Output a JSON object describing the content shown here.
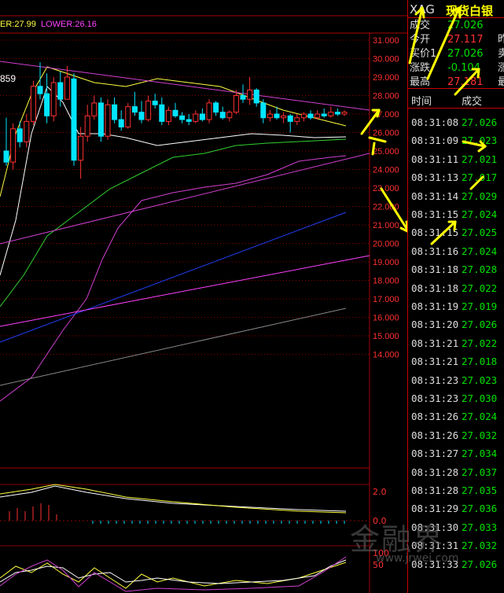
{
  "indicator": {
    "upper_partial": "ER:27.99",
    "lower": "LOWER:26.16",
    "high_marker": "859"
  },
  "chart_data": {
    "type": "candlestick",
    "title": "",
    "price_axis": [
      "31.000",
      "30.000",
      "29.000",
      "28.000",
      "27.000",
      "26.000",
      "25.000",
      "24.000",
      "23.000",
      "22.000",
      "21.000",
      "20.000",
      "19.000",
      "18.000",
      "17.000",
      "16.000",
      "15.000",
      "14.000"
    ],
    "ylim": [
      14.0,
      31.0
    ],
    "sub1_axis": [
      "2.0",
      "0.0"
    ],
    "sub2_axis": [
      "100",
      "50"
    ],
    "candles": [
      [
        25.0,
        26.8,
        24.2,
        24.4
      ],
      [
        24.4,
        26.5,
        24.0,
        26.2
      ],
      [
        26.2,
        26.6,
        25.2,
        25.5
      ],
      [
        25.5,
        27.0,
        25.2,
        26.6
      ],
      [
        26.6,
        28.8,
        26.4,
        28.5
      ],
      [
        28.5,
        29.8,
        27.8,
        28.1
      ],
      [
        28.1,
        29.2,
        26.5,
        26.9
      ],
      [
        26.9,
        29.0,
        26.6,
        28.7
      ],
      [
        28.7,
        29.3,
        27.4,
        27.8
      ],
      [
        27.8,
        29.6,
        28.2,
        29.0
      ],
      [
        28.9,
        29.2,
        24.2,
        24.5
      ],
      [
        24.5,
        26.3,
        23.5,
        25.8
      ],
      [
        25.8,
        27.5,
        25.5,
        26.9
      ],
      [
        26.9,
        28.0,
        26.7,
        27.6
      ],
      [
        27.6,
        27.9,
        25.5,
        25.8
      ],
      [
        25.8,
        27.8,
        25.6,
        27.5
      ],
      [
        27.5,
        27.9,
        26.5,
        26.7
      ],
      [
        26.7,
        27.2,
        26.1,
        26.3
      ],
      [
        26.3,
        27.6,
        26.2,
        27.4
      ],
      [
        27.4,
        28.2,
        26.9,
        27.1
      ],
      [
        27.1,
        27.7,
        26.5,
        26.7
      ],
      [
        26.7,
        28.0,
        26.6,
        27.7
      ],
      [
        27.7,
        28.1,
        27.3,
        27.5
      ],
      [
        27.5,
        27.9,
        26.4,
        26.6
      ],
      [
        26.6,
        27.4,
        26.4,
        27.2
      ],
      [
        27.2,
        27.6,
        26.8,
        26.9
      ],
      [
        26.9,
        27.1,
        26.5,
        26.7
      ],
      [
        26.7,
        27.0,
        26.4,
        26.6
      ],
      [
        26.6,
        27.2,
        26.5,
        27.0
      ],
      [
        27.0,
        27.3,
        26.6,
        26.7
      ],
      [
        26.7,
        27.8,
        26.5,
        27.6
      ],
      [
        27.6,
        27.7,
        26.9,
        27.1
      ],
      [
        27.1,
        27.4,
        26.7,
        26.8
      ],
      [
        26.8,
        27.2,
        26.6,
        27.1
      ],
      [
        27.1,
        28.3,
        27.0,
        28.0
      ],
      [
        28.0,
        28.6,
        27.6,
        27.8
      ],
      [
        27.8,
        29.0,
        27.5,
        28.3
      ],
      [
        28.3,
        28.4,
        27.4,
        27.6
      ],
      [
        27.6,
        27.8,
        26.5,
        26.8
      ],
      [
        26.8,
        27.2,
        26.6,
        27.0
      ],
      [
        27.0,
        27.4,
        26.7,
        26.8
      ],
      [
        26.8,
        27.1,
        26.5,
        26.9
      ],
      [
        26.9,
        27.0,
        26.0,
        26.6
      ],
      [
        26.6,
        27.0,
        26.4,
        26.8
      ],
      [
        26.8,
        27.1,
        26.6,
        27.0
      ],
      [
        27.0,
        27.2,
        26.7,
        26.8
      ],
      [
        26.8,
        27.2,
        26.7,
        27.0
      ],
      [
        27.0,
        27.3,
        26.8,
        26.9
      ],
      [
        26.9,
        27.4,
        26.8,
        27.1
      ],
      [
        27.1,
        27.3,
        26.9,
        27.0
      ],
      [
        27.0,
        27.2,
        26.9,
        27.1
      ]
    ]
  },
  "panel": {
    "symbol": "XAG",
    "name": "现货白银",
    "rows": [
      {
        "label": "成交",
        "value": "27.026",
        "cut": "",
        "color": "green"
      },
      {
        "label": "今开",
        "value": "27.117",
        "cut": "昨",
        "color": "red"
      },
      {
        "label": "买价1",
        "value": "27.026",
        "cut": "卖",
        "color": "green"
      },
      {
        "label": "涨跌",
        "value": "-0.104",
        "cut": "涨",
        "color": "green"
      },
      {
        "label": "最高",
        "value": "27.181",
        "cut": "最",
        "color": "red"
      }
    ],
    "col_time": "时间",
    "col_price": "成交",
    "ticks": [
      {
        "time": "08:31:08",
        "price": "27.026"
      },
      {
        "time": "08:31:09",
        "price": "27.023"
      },
      {
        "time": "08:31:11",
        "price": "27.021"
      },
      {
        "time": "08:31:13",
        "price": "27.017"
      },
      {
        "time": "08:31:14",
        "price": "27.029"
      },
      {
        "time": "08:31:15",
        "price": "27.024"
      },
      {
        "time": "08:31:15",
        "price": "27.025"
      },
      {
        "time": "08:31:16",
        "price": "27.024"
      },
      {
        "time": "08:31:18",
        "price": "27.028"
      },
      {
        "time": "08:31:18",
        "price": "27.022"
      },
      {
        "time": "08:31:19",
        "price": "27.019"
      },
      {
        "time": "08:31:20",
        "price": "27.026"
      },
      {
        "time": "08:31:21",
        "price": "27.022"
      },
      {
        "time": "08:31:21",
        "price": "27.018"
      },
      {
        "time": "08:31:23",
        "price": "27.023"
      },
      {
        "time": "08:31:23",
        "price": "27.030"
      },
      {
        "time": "08:31:26",
        "price": "27.024"
      },
      {
        "time": "08:31:26",
        "price": "27.032"
      },
      {
        "time": "08:31:27",
        "price": "27.034"
      },
      {
        "time": "08:31:28",
        "price": "27.037"
      },
      {
        "time": "08:31:28",
        "price": "27.035"
      },
      {
        "time": "08:31:29",
        "price": "27.036"
      },
      {
        "time": "08:31:30",
        "price": "27.033"
      },
      {
        "time": "08:31:31",
        "price": "27.032"
      },
      {
        "time": "08:31:33",
        "price": "27.026"
      }
    ]
  },
  "watermark": {
    "brand": "金融界",
    "url": "www.jrwei.com"
  },
  "colors": {
    "up": "#ff3030",
    "down": "#00e5ff",
    "grid": "#8a0000",
    "annotation": "#ffff00"
  }
}
